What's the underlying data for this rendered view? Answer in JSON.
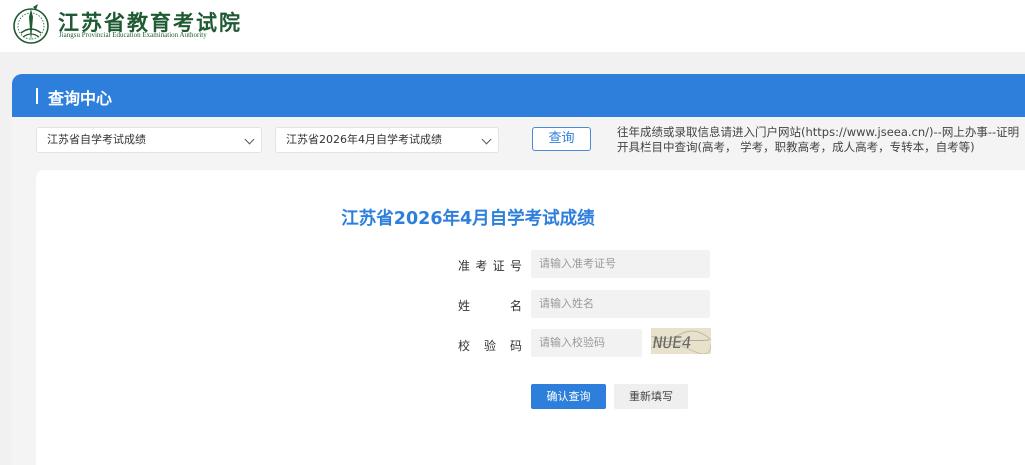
{
  "header": {
    "logo_title": "江苏省教育考试院",
    "logo_subtitle": "Jiangsu Provincial Education Examination Authority"
  },
  "panel": {
    "title": "查询中心"
  },
  "filters": {
    "category_selected": "江苏省自学考试成绩",
    "exam_selected": "江苏省2026年4月自学考试成绩",
    "query_label": "查询",
    "notice": "往年成绩或录取信息请进入门户网站(https://www.jseea.cn/)--网上办事--证明开具栏目中查询(高考， 学考，职教高考，成人高考，专转本，自考等)"
  },
  "form": {
    "title": "江苏省2026年4月自学考试成绩",
    "ticket_label": "准考证号",
    "ticket_placeholder": "请输入准考证号",
    "name_label": "姓名",
    "name_placeholder": "请输入姓名",
    "captcha_label": "校验码",
    "captcha_placeholder": "请输入校验码",
    "captcha_text": "NUE4",
    "submit_label": "确认查询",
    "reset_label": "重新填写"
  },
  "colors": {
    "primary": "#2e7fdc",
    "logo_green": "#1f5a33"
  }
}
